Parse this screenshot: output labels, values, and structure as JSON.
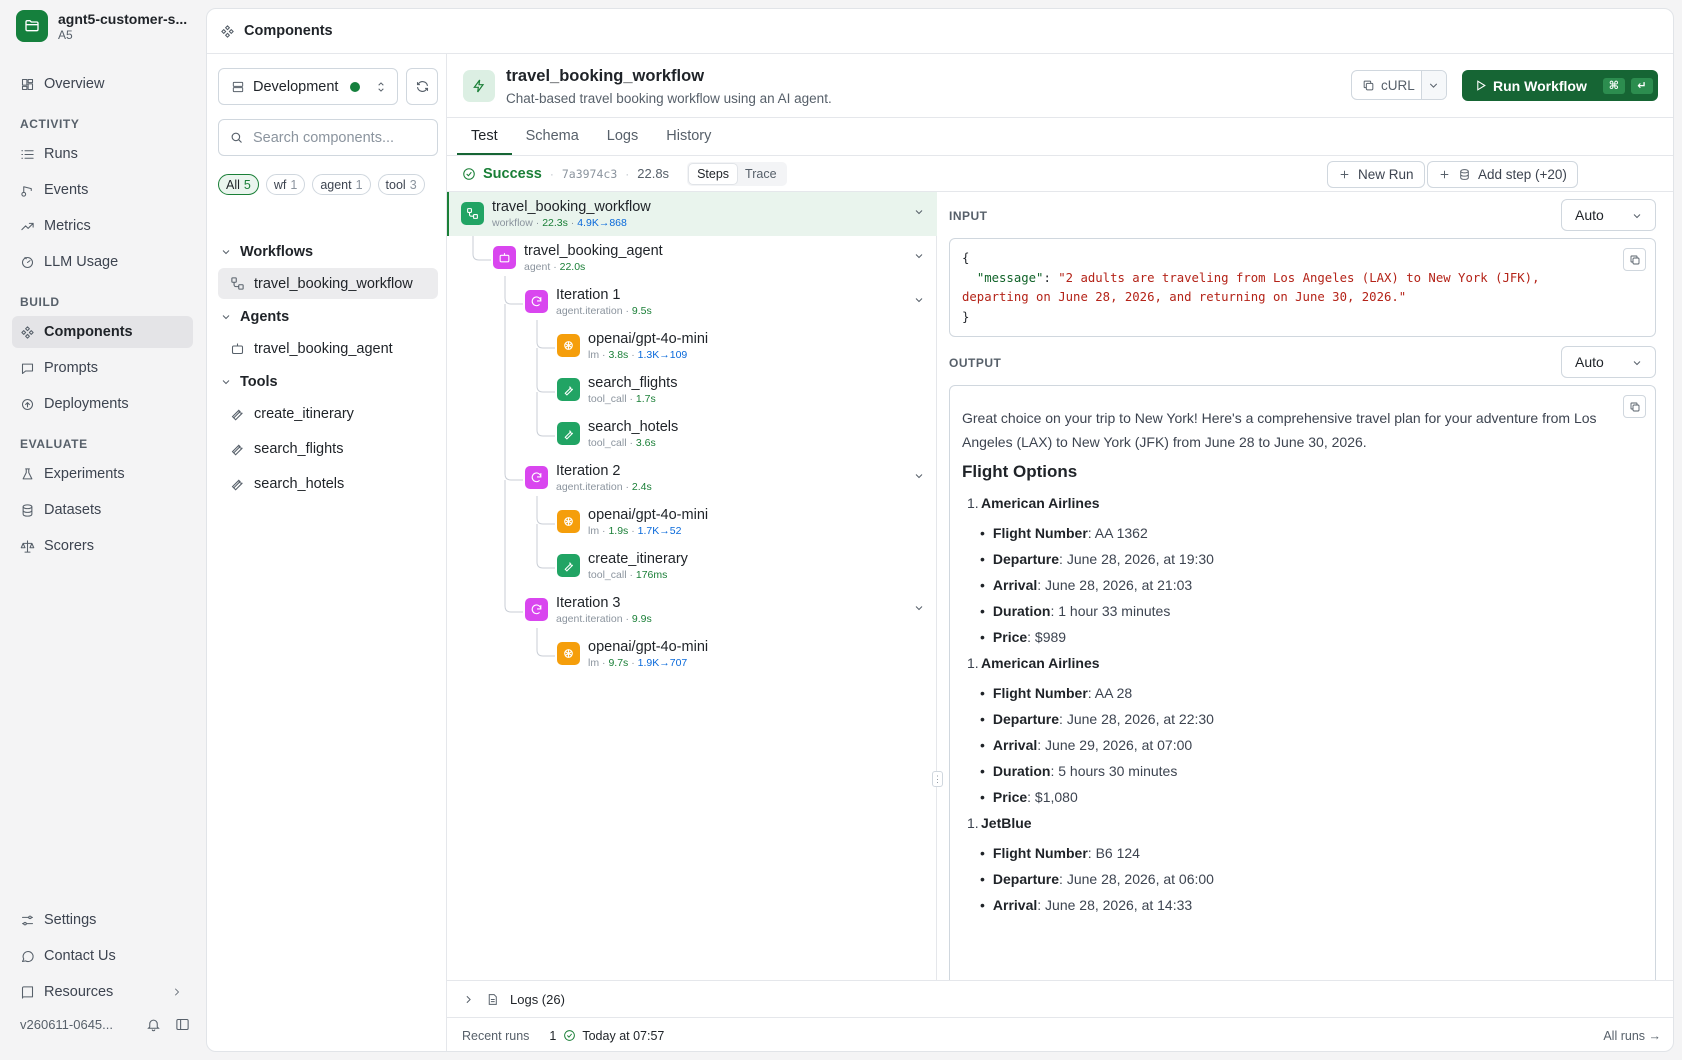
{
  "org": {
    "name": "agnt5-customer-s...",
    "sub": "A5"
  },
  "nav": {
    "overview": "Overview",
    "activity_header": "ACTIVITY",
    "runs": "Runs",
    "events": "Events",
    "metrics": "Metrics",
    "llm_usage": "LLM Usage",
    "build_header": "BUILD",
    "components": "Components",
    "prompts": "Prompts",
    "deployments": "Deployments",
    "evaluate_header": "EVALUATE",
    "experiments": "Experiments",
    "datasets": "Datasets",
    "scorers": "Scorers",
    "settings": "Settings",
    "contact": "Contact Us",
    "resources": "Resources",
    "version": "v260611-0645..."
  },
  "topbar": {
    "title": "Components"
  },
  "components_panel": {
    "environment": "Development",
    "search_placeholder": "Search components...",
    "filters": [
      {
        "label": "All",
        "count": "5"
      },
      {
        "label": "wf",
        "count": "1"
      },
      {
        "label": "agent",
        "count": "1"
      },
      {
        "label": "tool",
        "count": "3"
      }
    ],
    "groups": {
      "workflows": "Workflows",
      "agents": "Agents",
      "tools": "Tools"
    },
    "workflows": [
      "travel_booking_workflow"
    ],
    "agents": [
      "travel_booking_agent"
    ],
    "tools": [
      "create_itinerary",
      "search_flights",
      "search_hotels"
    ]
  },
  "detail": {
    "title": "travel_booking_workflow",
    "description": "Chat-based travel booking workflow using an AI agent.",
    "curl_label": "cURL",
    "run_label": "Run Workflow",
    "kbd_cmd": "⌘",
    "kbd_enter": "↵",
    "tabs": [
      "Test",
      "Schema",
      "Logs",
      "History"
    ]
  },
  "run": {
    "status": "Success",
    "hash": "7a3974c3",
    "duration": "22.8s",
    "view_steps": "Steps",
    "view_trace": "Trace",
    "new_run": "New Run",
    "add_step": "Add step (+20)"
  },
  "trace": [
    {
      "name": "travel_booking_workflow",
      "type": "workflow",
      "time": "22.3s",
      "tokens": "4.9K→868",
      "icon": "workflow-icon"
    },
    {
      "name": "travel_booking_agent",
      "type": "agent",
      "time": "22.0s",
      "tokens": "",
      "icon": "agent-icon"
    },
    {
      "name": "Iteration 1",
      "type": "agent.iteration",
      "time": "9.5s",
      "tokens": "",
      "icon": "loop-icon"
    },
    {
      "name": "openai/gpt-4o-mini",
      "type": "lm",
      "time": "3.8s",
      "tokens": "1.3K→109",
      "icon": "openai-icon"
    },
    {
      "name": "search_flights",
      "type": "tool_call",
      "time": "1.7s",
      "tokens": "",
      "icon": "wrench-icon"
    },
    {
      "name": "search_hotels",
      "type": "tool_call",
      "time": "3.6s",
      "tokens": "",
      "icon": "wrench-icon"
    },
    {
      "name": "Iteration 2",
      "type": "agent.iteration",
      "time": "2.4s",
      "tokens": "",
      "icon": "loop-icon"
    },
    {
      "name": "openai/gpt-4o-mini",
      "type": "lm",
      "time": "1.9s",
      "tokens": "1.7K→52",
      "icon": "openai-icon"
    },
    {
      "name": "create_itinerary",
      "type": "tool_call",
      "time": "176ms",
      "tokens": "",
      "icon": "wrench-icon"
    },
    {
      "name": "Iteration 3",
      "type": "agent.iteration",
      "time": "9.9s",
      "tokens": "",
      "icon": "loop-icon"
    },
    {
      "name": "openai/gpt-4o-mini",
      "type": "lm",
      "time": "9.7s",
      "tokens": "1.9K→707",
      "icon": "openai-icon"
    }
  ],
  "io": {
    "input_label": "INPUT",
    "output_label": "OUTPUT",
    "format": "Auto",
    "input_key": "\"message\"",
    "input_value_line1": "\"2 adults are traveling from Los Angeles (LAX) to New York (JFK),",
    "input_value_line2": "departing on June 28, 2026, and returning on June 30, 2026.\"",
    "output_intro": "Great choice on your trip to New York! Here's a comprehensive travel plan for your adventure from Los Angeles (LAX) to New York (JFK) from June 28 to June 30, 2026.",
    "output_heading": "Flight Options",
    "flights": [
      {
        "airline": "American Airlines",
        "details": [
          {
            "k": "Flight Number",
            "v": ": AA 1362"
          },
          {
            "k": "Departure",
            "v": ": June 28, 2026, at 19:30"
          },
          {
            "k": "Arrival",
            "v": ": June 28, 2026, at 21:03"
          },
          {
            "k": "Duration",
            "v": ": 1 hour 33 minutes"
          },
          {
            "k": "Price",
            "v": ": $989"
          }
        ]
      },
      {
        "airline": "American Airlines",
        "details": [
          {
            "k": "Flight Number",
            "v": ": AA 28"
          },
          {
            "k": "Departure",
            "v": ": June 28, 2026, at 22:30"
          },
          {
            "k": "Arrival",
            "v": ": June 29, 2026, at 07:00"
          },
          {
            "k": "Duration",
            "v": ": 5 hours 30 minutes"
          },
          {
            "k": "Price",
            "v": ": $1,080"
          }
        ]
      },
      {
        "airline": "JetBlue",
        "details": [
          {
            "k": "Flight Number",
            "v": ": B6 124"
          },
          {
            "k": "Departure",
            "v": ": June 28, 2026, at 06:00"
          },
          {
            "k": "Arrival",
            "v": ": June 28, 2026, at 14:33"
          }
        ]
      }
    ]
  },
  "bottom": {
    "logs": "Logs (26)",
    "recent_runs": "Recent runs",
    "recent_count": "1",
    "recent_when": "Today at 07:57",
    "all_runs": "All runs →"
  }
}
